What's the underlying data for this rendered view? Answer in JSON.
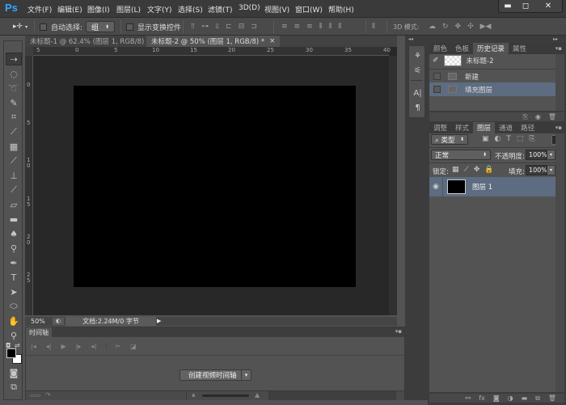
{
  "app": {
    "logo": "Ps"
  },
  "menu": [
    "文件(F)",
    "编辑(E)",
    "图像(I)",
    "图层(L)",
    "文字(Y)",
    "选择(S)",
    "滤镜(T)",
    "3D(D)",
    "视图(V)",
    "窗口(W)",
    "帮助(H)"
  ],
  "window_controls": {
    "minimize": "▬",
    "maximize": "◻",
    "close": "✕"
  },
  "options": {
    "tool_icon": "▸✛",
    "auto_select_label": "自动选择:",
    "auto_select_value": "组",
    "show_transform_label": "显示变换控件",
    "mode_3d_label": "3D 模式:"
  },
  "tabs": [
    {
      "label": "未标题-1 @ 62.4% (图层 1, RGB/8) *",
      "close": "×",
      "active": false
    },
    {
      "label": "未标题-2 @ 50% (图层 1, RGB/8) *",
      "close": "×",
      "active": true
    }
  ],
  "rulers": {
    "horizontal": [
      "5",
      "0",
      "5",
      "10",
      "15",
      "20",
      "25",
      "30",
      "35",
      "40"
    ],
    "vertical": [
      "0",
      "5",
      "10",
      "15",
      "20",
      "25"
    ]
  },
  "status": {
    "zoom": "50%",
    "doc_info": "文档:2.24M/0 字节",
    "arrow": "▶"
  },
  "timeline": {
    "tab": "时间轴",
    "create_button": "创建视频时间轴",
    "dropdown": "▾",
    "controls": [
      "|◂",
      "◂|",
      "▶",
      "|▸",
      "◂)",
      "✂",
      "◪"
    ]
  },
  "history_panel": {
    "tabs": [
      {
        "label": "颜色",
        "active": false
      },
      {
        "label": "色板",
        "active": false
      },
      {
        "label": "历史记录",
        "active": true
      },
      {
        "label": "属性",
        "active": false
      }
    ],
    "snapshot": "未标题-2",
    "items": [
      {
        "label": "新建",
        "selected": false
      },
      {
        "label": "填充图层",
        "selected": true
      }
    ],
    "footer_icons": [
      "new-document-from-state",
      "camera",
      "trash"
    ]
  },
  "layers_panel": {
    "tabs": [
      {
        "label": "调整",
        "active": false
      },
      {
        "label": "样式",
        "active": false
      },
      {
        "label": "图层",
        "active": true
      },
      {
        "label": "通道",
        "active": false
      },
      {
        "label": "路径",
        "active": false
      }
    ],
    "filter_type": "类型",
    "blend_mode": "正常",
    "opacity_label": "不透明度:",
    "opacity_value": "100%",
    "lock_label": "锁定:",
    "fill_label": "填充:",
    "fill_value": "100%",
    "layers": [
      {
        "name": "图层 1",
        "visible": true,
        "selected": true
      }
    ],
    "footer_icons": [
      "link",
      "fx",
      "mask",
      "adjustment",
      "group",
      "new-layer",
      "trash"
    ]
  },
  "colors": {
    "accent": "#31a8ff",
    "selected_row": "#5a6a80",
    "canvas": "#000000"
  }
}
